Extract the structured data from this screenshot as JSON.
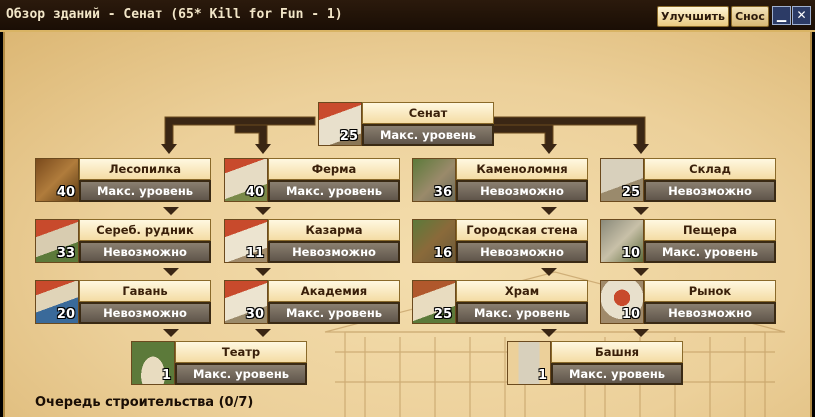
{
  "window": {
    "title": "Обзор зданий - Сенат (65* Kill for Fun - 1)",
    "upgrade_tab": "Улучшить",
    "demolish_tab": "Снос"
  },
  "buildings": [
    {
      "id": "senate",
      "name": "Сенат",
      "level": "25",
      "status": "Макс. уровень"
    },
    {
      "id": "lumber",
      "name": "Лесопилка",
      "level": "40",
      "status": "Макс. уровень"
    },
    {
      "id": "farm",
      "name": "Ферма",
      "level": "40",
      "status": "Макс. уровень"
    },
    {
      "id": "quarry",
      "name": "Каменоломня",
      "level": "36",
      "status": "Невозможно"
    },
    {
      "id": "warehouse",
      "name": "Склад",
      "level": "25",
      "status": "Невозможно"
    },
    {
      "id": "silver",
      "name": "Сереб. рудник",
      "level": "33",
      "status": "Невозможно"
    },
    {
      "id": "barracks",
      "name": "Казарма",
      "level": "11",
      "status": "Невозможно"
    },
    {
      "id": "wall",
      "name": "Городская стена",
      "level": "16",
      "status": "Невозможно"
    },
    {
      "id": "cave",
      "name": "Пещера",
      "level": "10",
      "status": "Макс. уровень"
    },
    {
      "id": "harbor",
      "name": "Гавань",
      "level": "20",
      "status": "Невозможно"
    },
    {
      "id": "academy",
      "name": "Академия",
      "level": "30",
      "status": "Макс. уровень"
    },
    {
      "id": "temple",
      "name": "Храм",
      "level": "25",
      "status": "Макс. уровень"
    },
    {
      "id": "market",
      "name": "Рынок",
      "level": "10",
      "status": "Невозможно"
    },
    {
      "id": "theater",
      "name": "Театр",
      "level": "1",
      "status": "Макс. уровень"
    },
    {
      "id": "tower",
      "name": "Башня",
      "level": "1",
      "status": "Макс. уровень"
    }
  ],
  "queue": {
    "title": "Очередь строительства (0/7)"
  },
  "colors": {
    "frame": "#d9b464",
    "parchment": "#ecd09a",
    "connector": "#3a2614",
    "status_bg": "#6f6558"
  }
}
